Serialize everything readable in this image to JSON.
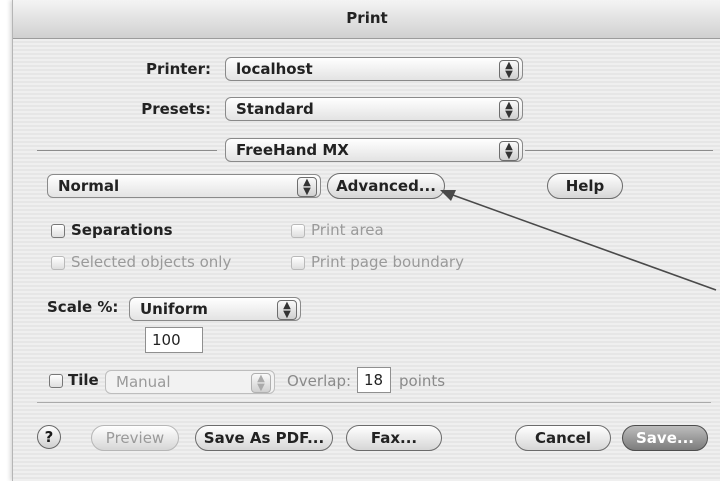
{
  "dialog": {
    "title": "Print"
  },
  "printer": {
    "label": "Printer:",
    "value": "localhost"
  },
  "presets": {
    "label": "Presets:",
    "value": "Standard"
  },
  "panel": {
    "value": "FreeHand MX"
  },
  "mode": {
    "value": "Normal"
  },
  "buttons": {
    "advanced": "Advanced...",
    "help": "Help",
    "preview": "Preview",
    "save_as_pdf": "Save As PDF...",
    "fax": "Fax...",
    "cancel": "Cancel",
    "save": "Save...",
    "question": "?"
  },
  "options": {
    "separations": "Separations",
    "print_area": "Print area",
    "selected_only": "Selected objects only",
    "print_boundary": "Print page boundary"
  },
  "scale": {
    "label": "Scale %:",
    "mode": "Uniform",
    "value": "100"
  },
  "tile": {
    "label": "Tile",
    "mode": "Manual",
    "overlap_label": "Overlap:",
    "overlap_value": "18",
    "unit": "points"
  },
  "icons": {
    "stepper": "stepper-arrows-icon",
    "arrow": "annotation-arrow"
  }
}
